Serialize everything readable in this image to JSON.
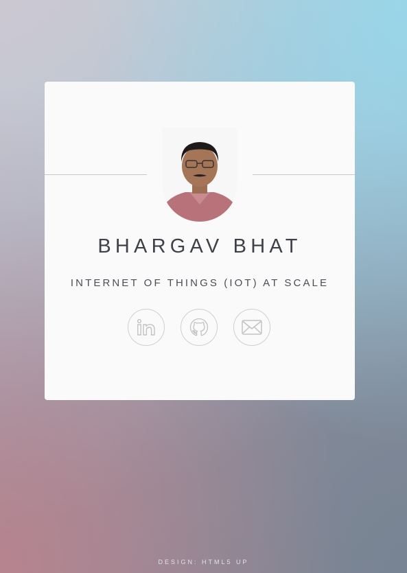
{
  "profile": {
    "name": "BHARGAV BHAT",
    "tagline": "INTERNET OF THINGS (IOT) AT SCALE"
  },
  "social": {
    "linkedin_icon": "linkedin-icon",
    "github_icon": "github-icon",
    "email_icon": "envelope-icon"
  },
  "footer": {
    "credit": "DESIGN: HTML5 UP"
  },
  "colors": {
    "card_background": "#fafafa",
    "text": "#3e4147",
    "icon_stroke": "#cfcfcf"
  }
}
